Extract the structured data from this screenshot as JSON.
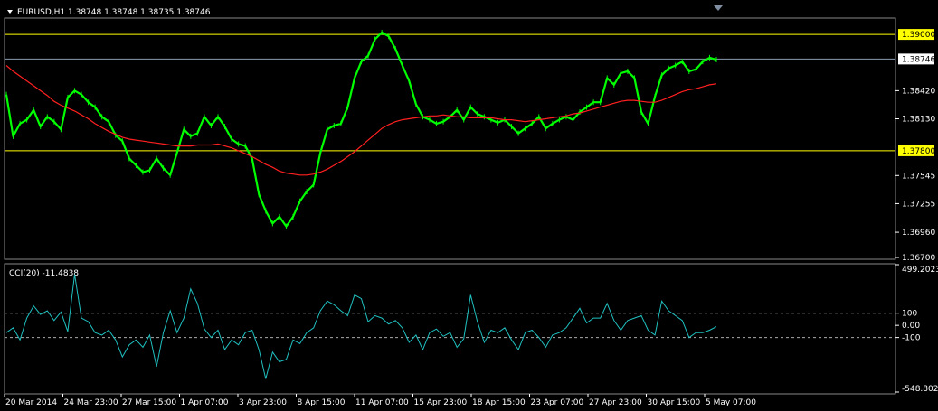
{
  "header": {
    "symbol_label": "EURUSD,H1",
    "ohlc": "1.38748 1.38748 1.38735 1.38746"
  },
  "colors": {
    "background": "#000000",
    "price": "#00ff00",
    "ma": "#ff2020",
    "cci": "#20c0c0",
    "hline": "#ffff00",
    "grid_text": "#ffffff"
  },
  "chart_data": [
    {
      "type": "line",
      "title": "",
      "x_ticks": [
        "20 Mar 2014",
        "24 Mar 23:00",
        "27 Mar 15:00",
        "1 Apr 07:00",
        "3 Apr 23:00",
        "8 Apr 15:00",
        "11 Apr 07:00",
        "15 Apr 23:00",
        "18 Apr 15:00",
        "23 Apr 07:00",
        "27 Apr 23:00",
        "30 Apr 15:00",
        "5 May 07:00"
      ],
      "y_ticks": [
        "1.38420",
        "1.38130",
        "1.37545",
        "1.37255",
        "1.36960",
        "1.36700"
      ],
      "ylim": [
        1.367,
        1.3915
      ],
      "horizontal_levels": [
        {
          "value": 1.39,
          "label": "1.39000"
        },
        {
          "value": 1.378,
          "label": "1.37800"
        }
      ],
      "current_price": {
        "value": 1.38746,
        "label": "1.38746"
      },
      "series": [
        {
          "values": [
            1.3838,
            1.3795,
            1.3808,
            1.3812,
            1.3822,
            1.3805,
            1.3815,
            1.381,
            1.3802,
            1.3835,
            1.3842,
            1.3838,
            1.383,
            1.3825,
            1.3815,
            1.381,
            1.3796,
            1.379,
            1.3772,
            1.3765,
            1.3758,
            1.376,
            1.3772,
            1.3762,
            1.3755,
            1.3778,
            1.3802,
            1.3795,
            1.3798,
            1.3815,
            1.3806,
            1.3815,
            1.3805,
            1.3792,
            1.3787,
            1.3785,
            1.3772,
            1.3735,
            1.3718,
            1.3705,
            1.3712,
            1.3702,
            1.3712,
            1.3728,
            1.3738,
            1.3745,
            1.3778,
            1.3802,
            1.3806,
            1.3808,
            1.3825,
            1.3855,
            1.3872,
            1.3878,
            1.3895,
            1.3902,
            1.3898,
            1.3885,
            1.3868,
            1.3852,
            1.3828,
            1.3815,
            1.3812,
            1.3808,
            1.381,
            1.3815,
            1.3822,
            1.3812,
            1.3825,
            1.3818,
            1.3815,
            1.3812,
            1.3809,
            1.3812,
            1.3805,
            1.3798,
            1.3803,
            1.3808,
            1.3815,
            1.3803,
            1.3808,
            1.3812,
            1.3815,
            1.3812,
            1.382,
            1.3825,
            1.383,
            1.383,
            1.3855,
            1.3848,
            1.386,
            1.3862,
            1.3855,
            1.382,
            1.3808,
            1.3836,
            1.3858,
            1.3865,
            1.3868,
            1.3872,
            1.3862,
            1.3864,
            1.3872,
            1.3876,
            1.3874
          ]
        },
        {
          "name": "",
          "values": [
            1.3868,
            1.3862,
            1.3857,
            1.3852,
            1.3847,
            1.3842,
            1.3837,
            1.3831,
            1.3827,
            1.3824,
            1.3821,
            1.3817,
            1.3813,
            1.3808,
            1.3804,
            1.38,
            1.3797,
            1.3794,
            1.3792,
            1.3791,
            1.379,
            1.3789,
            1.3788,
            1.3787,
            1.3786,
            1.3785,
            1.3785,
            1.3785,
            1.3786,
            1.3786,
            1.3786,
            1.3787,
            1.3785,
            1.3783,
            1.378,
            1.3777,
            1.3774,
            1.377,
            1.3766,
            1.3763,
            1.3759,
            1.3757,
            1.3756,
            1.3755,
            1.3755,
            1.3756,
            1.3758,
            1.3761,
            1.3765,
            1.3769,
            1.3774,
            1.3779,
            1.3785,
            1.3791,
            1.3797,
            1.3803,
            1.3807,
            1.381,
            1.3812,
            1.3813,
            1.3814,
            1.3815,
            1.3816,
            1.3816,
            1.3817,
            1.3816,
            1.3815,
            1.3815,
            1.3814,
            1.3814,
            1.3814,
            1.3814,
            1.3813,
            1.3812,
            1.3812,
            1.3811,
            1.381,
            1.3811,
            1.3812,
            1.3813,
            1.3814,
            1.3815,
            1.3816,
            1.3818,
            1.3819,
            1.3821,
            1.3823,
            1.3825,
            1.3827,
            1.3829,
            1.3831,
            1.3832,
            1.3832,
            1.3831,
            1.383,
            1.383,
            1.3832,
            1.3835,
            1.3838,
            1.3841,
            1.3843,
            1.3844,
            1.3846,
            1.3848,
            1.3849
          ]
        }
      ]
    },
    {
      "type": "line",
      "title": "CCI(20) -11.4838",
      "y_ticks": [
        "499.2023",
        "100",
        "0.00",
        "-100",
        "-548.8021"
      ],
      "ylim": [
        -548.8021,
        499.2023
      ],
      "horizontal_levels": [
        {
          "value": 100,
          "label": "100"
        },
        {
          "value": -100,
          "label": "-100"
        }
      ],
      "series": [
        {
          "name": "CCI(20)",
          "values": [
            -60,
            -20,
            -120,
            60,
            160,
            90,
            120,
            40,
            110,
            -50,
            420,
            60,
            30,
            -60,
            -80,
            -40,
            -120,
            -260,
            -160,
            -120,
            -180,
            -80,
            -340,
            -60,
            120,
            -60,
            60,
            300,
            180,
            -30,
            -100,
            -40,
            -200,
            -120,
            -160,
            -60,
            -40,
            -200,
            -440,
            -220,
            -300,
            -280,
            -120,
            -150,
            -60,
            -20,
            120,
            200,
            170,
            120,
            80,
            250,
            220,
            30,
            80,
            60,
            10,
            40,
            -20,
            -140,
            -80,
            -200,
            -60,
            -30,
            -90,
            -60,
            -180,
            -110,
            250,
            30,
            -140,
            -40,
            -60,
            -20,
            -120,
            -200,
            -60,
            -40,
            -100,
            -180,
            -80,
            -60,
            -20,
            60,
            140,
            20,
            60,
            60,
            180,
            40,
            -40,
            40,
            60,
            80,
            -40,
            -80,
            200,
            120,
            80,
            40,
            -100,
            -60,
            -60,
            -40,
            -11
          ]
        }
      ]
    }
  ]
}
